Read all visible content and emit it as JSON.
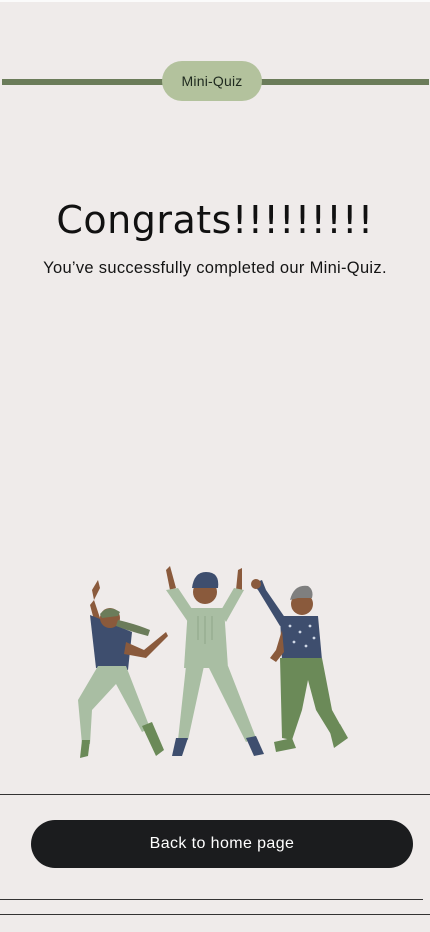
{
  "header": {
    "pill_label": "Mini-Quiz"
  },
  "main": {
    "title": "Congrats!!!!!!!!!",
    "subtitle": "You’ve successfully completed our Mini-Quiz."
  },
  "footer": {
    "home_button_label": "Back to home page"
  },
  "colors": {
    "background": "#efebea",
    "accent_green": "#6b7c5a",
    "pill_green": "#b3c29d",
    "button_dark": "#1b1c1e"
  },
  "illustration": {
    "icon": "dancing-people-illustration"
  }
}
